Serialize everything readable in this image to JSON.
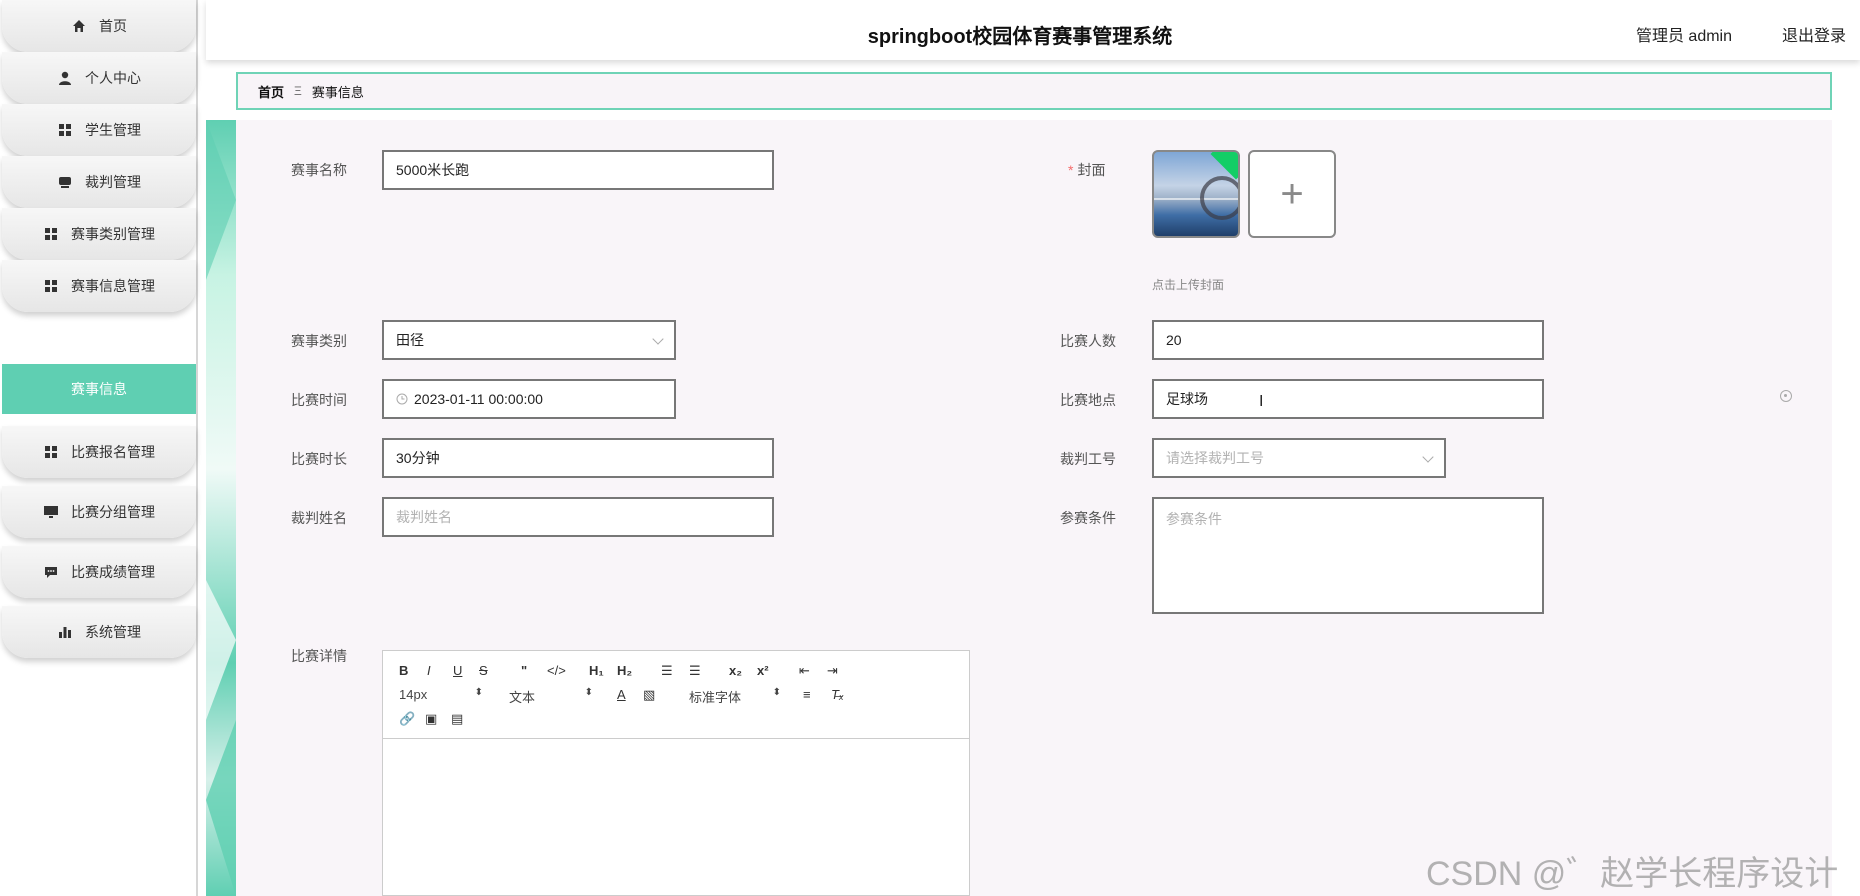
{
  "sidebar": {
    "items": [
      {
        "label": "首页",
        "icon": "home-icon"
      },
      {
        "label": "个人中心",
        "icon": "user-icon"
      },
      {
        "label": "学生管理",
        "icon": "grid-icon"
      },
      {
        "label": "裁判管理",
        "icon": "device-icon"
      },
      {
        "label": "赛事类别管理",
        "icon": "grid-icon"
      },
      {
        "label": "赛事信息管理",
        "icon": "grid-icon"
      },
      {
        "label": "赛事信息",
        "active": true
      },
      {
        "label": "比赛报名管理",
        "icon": "grid-icon"
      },
      {
        "label": "比赛分组管理",
        "icon": "monitor-icon"
      },
      {
        "label": "比赛成绩管理",
        "icon": "chat-icon"
      },
      {
        "label": "系统管理",
        "icon": "bar-chart-icon"
      }
    ]
  },
  "header": {
    "title": "springboot校园体育赛事管理系统",
    "user": "管理员 admin",
    "logout": "退出登录"
  },
  "breadcrumb": {
    "home": "首页",
    "separator": "Ξ",
    "current": "赛事信息"
  },
  "form": {
    "name": {
      "label": "赛事名称",
      "value": "5000米长跑"
    },
    "cover": {
      "label": "封面",
      "tip": "点击上传封面"
    },
    "category": {
      "label": "赛事类别",
      "value": "田径"
    },
    "participants": {
      "label": "比赛人数",
      "value": "20"
    },
    "time": {
      "label": "比赛时间",
      "value": "2023-01-11 00:00:00"
    },
    "location": {
      "label": "比赛地点",
      "value": "足球场"
    },
    "duration": {
      "label": "比赛时长",
      "value": "30分钟"
    },
    "referee_id": {
      "label": "裁判工号",
      "placeholder": "请选择裁判工号"
    },
    "referee_name": {
      "label": "裁判姓名",
      "placeholder": "裁判姓名"
    },
    "conditions": {
      "label": "参赛条件",
      "placeholder": "参赛条件"
    },
    "details": {
      "label": "比赛详情"
    }
  },
  "editor": {
    "font_size": "14px",
    "text_style": "文本",
    "font_family": "标准字体"
  },
  "watermark": "CSDN @゛赵学长程序设计",
  "colors": {
    "accent": "#5fcfb2",
    "required": "#f56c6c",
    "border": "#6fd3b6"
  }
}
